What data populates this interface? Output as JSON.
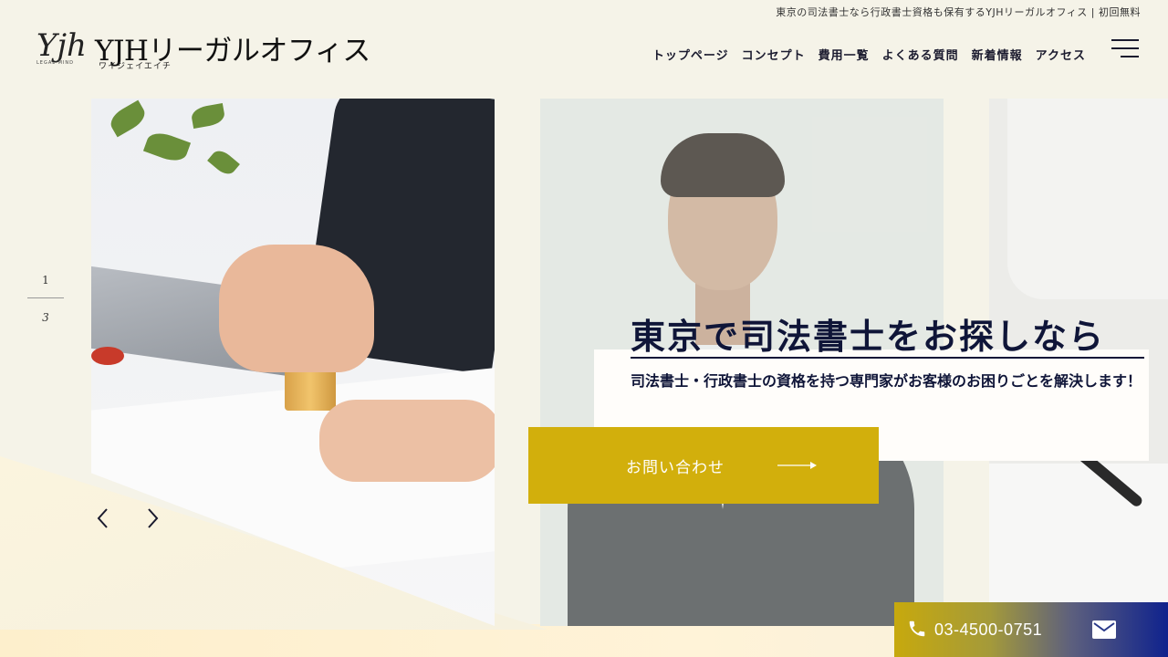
{
  "header": {
    "tagline": "東京の司法書士なら行政書士資格も保有するYJHリーガルオフィス | 初回無料",
    "logo_script": "Yjh",
    "logo_sub": "LEGAL MIND",
    "logo_name": "YJHリーガルオフィス",
    "logo_reading": "ワイジェイエイチ",
    "nav": [
      "トップページ",
      "コンセプト",
      "費用一覧",
      "よくある質問",
      "新着情報",
      "アクセス"
    ]
  },
  "slider": {
    "current": "1",
    "total": "3"
  },
  "hero": {
    "title": "東京で司法書士をお探しなら",
    "subtitle": "司法書士・行政書士の資格を持つ専門家がお客様のお困りごとを解決します！",
    "cta_label": "お問い合わせ"
  },
  "contact": {
    "phone": "03-4500-0751"
  },
  "colors": {
    "accent": "#d2af0c",
    "navy": "#0f1538",
    "background": "#f5f3e8"
  },
  "icons": [
    "menu-icon",
    "chevron-left-icon",
    "chevron-right-icon",
    "arrow-right-icon",
    "phone-icon",
    "mail-icon"
  ]
}
